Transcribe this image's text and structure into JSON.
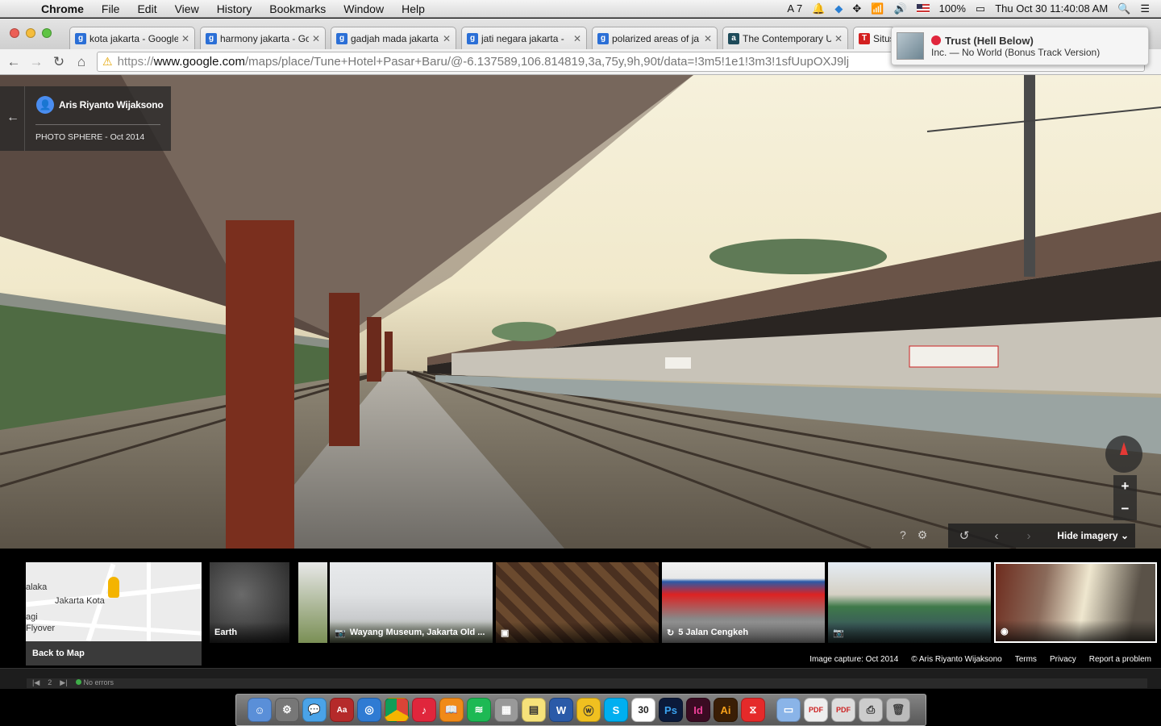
{
  "menubar": {
    "items": [
      "Chrome",
      "File",
      "Edit",
      "View",
      "History",
      "Bookmarks",
      "Window",
      "Help"
    ],
    "status": {
      "adobe_count": "7",
      "battery": "100%",
      "datetime": "Thu Oct 30  11:40:08 AM"
    }
  },
  "tabs": [
    {
      "title": "kota jakarta - Google",
      "favicon": "google-icon",
      "color": "#2b6fd6"
    },
    {
      "title": "harmony jakarta - Go",
      "favicon": "google-icon",
      "color": "#2b6fd6"
    },
    {
      "title": "gadjah mada jakarta",
      "favicon": "google-icon",
      "color": "#2b6fd6"
    },
    {
      "title": "jati negara jakarta -",
      "favicon": "google-icon",
      "color": "#2b6fd6"
    },
    {
      "title": "polarized areas of ja",
      "favicon": "google-icon",
      "color": "#2b6fd6"
    },
    {
      "title": "The Contemporary U",
      "favicon": "academia-icon",
      "color": "#1e4b5a"
    },
    {
      "title": "Situs",
      "favicon": "t-icon",
      "color": "#d32020"
    }
  ],
  "toolbar": {
    "url_scheme": "https://",
    "url_host": "www.google.com",
    "url_path": "/maps/place/Tune+Hotel+Pasar+Baru/@-6.137589,106.814819,3a,75y,9h,90t/data=!3m5!1e1!3m3!1sfUupOXJ9lj"
  },
  "notification": {
    "title": "Trust (Hell Below)",
    "subtitle": "Inc. — No World (Bonus Track Version)"
  },
  "streetview": {
    "author": "Aris Riyanto Wijaksono",
    "meta": "PHOTO SPHERE - Oct 2014",
    "hide_imagery": "Hide imagery"
  },
  "filmstrip": {
    "map_label": "Jakarta Kota",
    "map_label2": "Flyover",
    "map_label3": "alaka",
    "map_label4": "agi",
    "back_to_map": "Back to Map",
    "items": [
      {
        "caption": "Earth"
      },
      {
        "caption": ""
      },
      {
        "caption": "Wayang Museum, Jakarta Old ..."
      },
      {
        "caption": ""
      },
      {
        "caption": "5 Jalan Cengkeh"
      },
      {
        "caption": ""
      },
      {
        "caption": ""
      }
    ],
    "footer": {
      "capture": "Image capture: Oct 2014",
      "copyright": "© Aris Riyanto Wijaksono",
      "terms": "Terms",
      "privacy": "Privacy",
      "report": "Report a problem"
    }
  },
  "statusbar": {
    "page": "2",
    "errors": "No errors"
  },
  "dock": {
    "calendar_day": "30",
    "apps": [
      "finder-icon",
      "preferences-icon",
      "messages-icon",
      "dictionary-icon",
      "safari-icon",
      "chrome-icon",
      "itunes-icon",
      "ibooks-icon",
      "spotify-icon",
      "calculator-icon",
      "stickies-icon",
      "word-icon",
      "reference-icon",
      "skype-icon",
      "calendar-icon",
      "photoshop-icon",
      "indesign-icon",
      "illustrator-icon",
      "acrobat-icon",
      "folder-icon",
      "pdf-icon",
      "pdf2-icon",
      "printer-icon",
      "trash-icon"
    ]
  }
}
